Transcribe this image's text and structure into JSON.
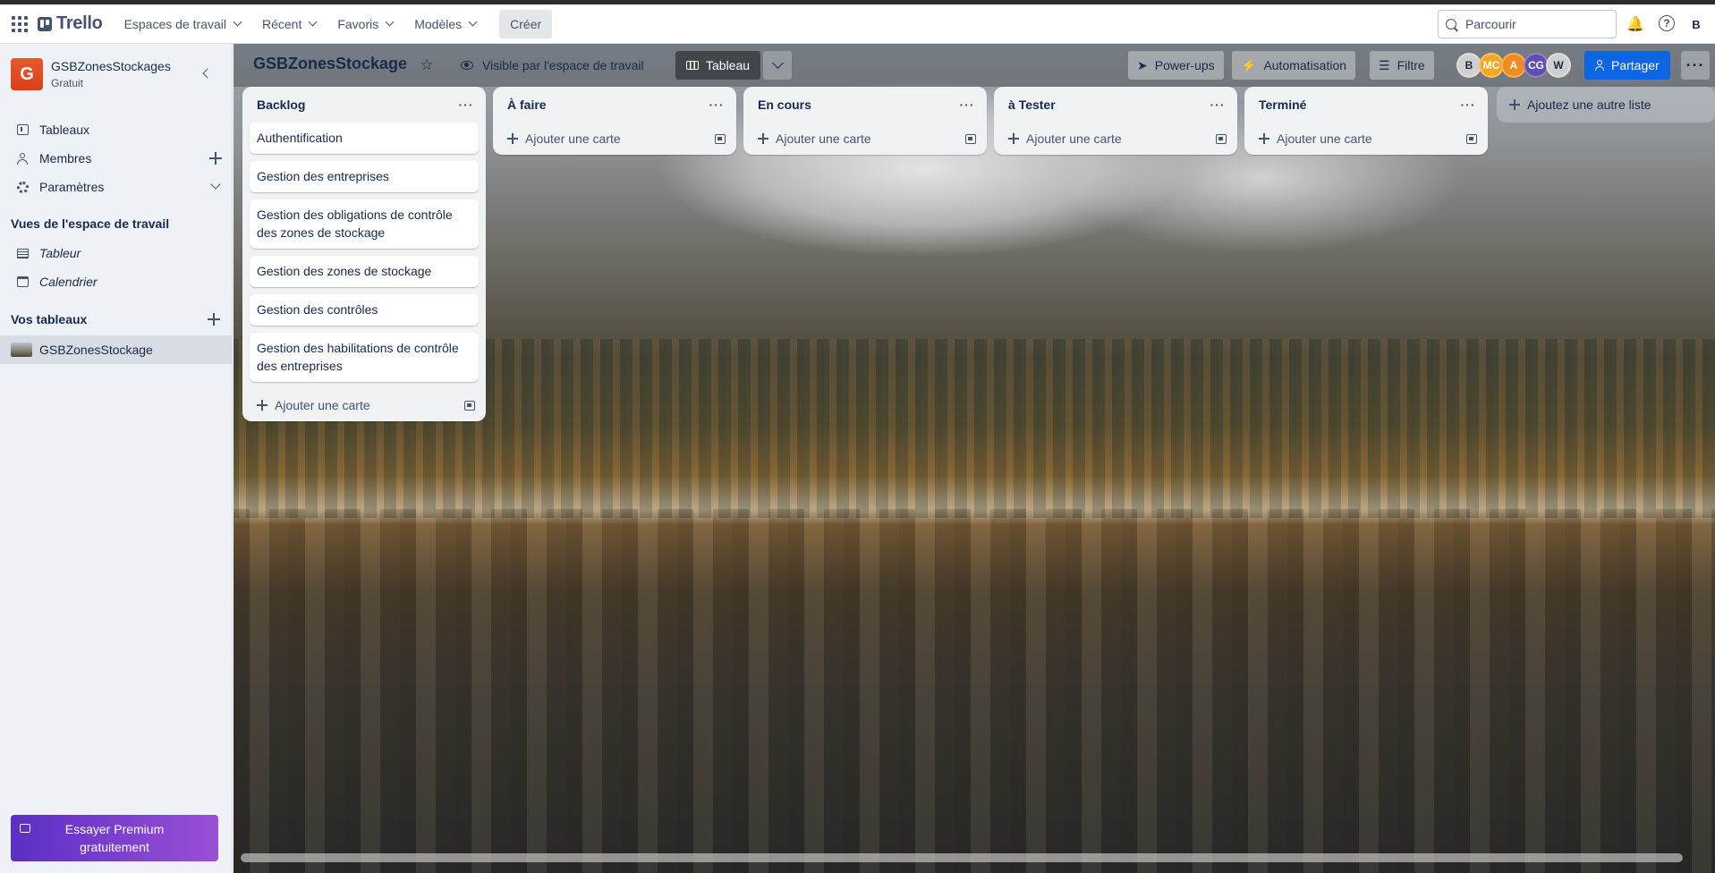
{
  "header": {
    "app_name": "Trello",
    "nav": [
      "Espaces de travail",
      "Récent",
      "Favoris",
      "Modèles"
    ],
    "create_label": "Créer",
    "search_placeholder": "Parcourir",
    "user_initial": "B"
  },
  "sidebar": {
    "workspace_initial": "G",
    "workspace_name": "GSBZonesStockages",
    "workspace_plan": "Gratuit",
    "items": [
      {
        "label": "Tableaux",
        "icon": "board-icon"
      },
      {
        "label": "Membres",
        "icon": "person-icon"
      },
      {
        "label": "Paramètres",
        "icon": "gear-icon"
      }
    ],
    "views_title": "Vues de l'espace de travail",
    "views": [
      {
        "label": "Tableur",
        "icon": "table-icon"
      },
      {
        "label": "Calendrier",
        "icon": "calendar-icon"
      }
    ],
    "boards_title": "Vos tableaux",
    "boards": [
      "GSBZonesStockage"
    ],
    "premium_label": "Essayer Premium gratuitement"
  },
  "board": {
    "title": "GSBZonesStockage",
    "visibility": "Visible par l'espace de travail",
    "view_label": "Tableau",
    "powerups": "Power-ups",
    "automation": "Automatisation",
    "filter": "Filtre",
    "members": [
      {
        "initials": "B",
        "color": "#c9c9c9"
      },
      {
        "initials": "MC",
        "color": "#f5a623"
      },
      {
        "initials": "A",
        "color": "#f08c1c"
      },
      {
        "initials": "CG",
        "color": "#5e4db2"
      },
      {
        "initials": "W",
        "color": "#c9c9c9"
      }
    ],
    "share_label": "Partager",
    "more_label": "···",
    "add_list_label": "Ajoutez une autre liste",
    "add_card_label": "Ajouter une carte",
    "lists": [
      {
        "title": "Backlog",
        "cards": [
          "Authentification",
          "Gestion des entreprises",
          "Gestion des obligations de contrôle des zones de stockage",
          "Gestion des zones de stockage",
          "Gestion des contrôles",
          "Gestion des habilitations de contrôle des entreprises"
        ]
      },
      {
        "title": "À faire",
        "cards": []
      },
      {
        "title": "En cours",
        "cards": []
      },
      {
        "title": "à Tester",
        "cards": []
      },
      {
        "title": "Terminé",
        "cards": []
      }
    ]
  },
  "colors": {
    "accent": "#0c66e4",
    "workspace_logo": "#e2501f",
    "premium_start": "#5b2fc4",
    "premium_end": "#9b4fd8"
  }
}
